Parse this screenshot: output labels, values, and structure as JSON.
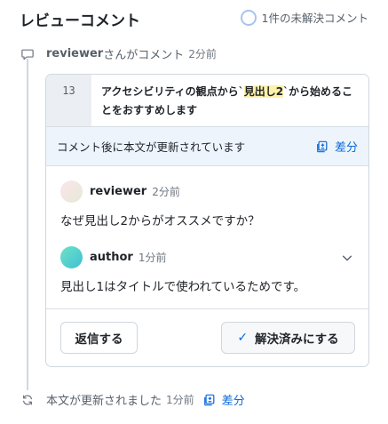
{
  "header": {
    "title": "レビューコメント",
    "unresolved": "1件の未解決コメント"
  },
  "event_comment": {
    "user": "reviewer",
    "action": "さんがコメント",
    "time": "2分前"
  },
  "code": {
    "line_number": "13",
    "text_before": "アクセシビリティの観点から`",
    "highlight": "見出し2",
    "text_after": "`から始めることをおすすめします"
  },
  "notice": {
    "text": "コメント後に本文が更新されています",
    "diff_label": "差分"
  },
  "comments": [
    {
      "user": "reviewer",
      "time": "2分前",
      "body": "なぜ見出し2からがオススメですか？"
    },
    {
      "user": "author",
      "time": "1分前",
      "body": "見出し1はタイトルで使われているためです。"
    }
  ],
  "actions": {
    "reply": "返信する",
    "resolve": "解決済みにする"
  },
  "event_update": {
    "text": "本文が更新されました",
    "time": "1分前",
    "diff_label": "差分"
  },
  "colors": {
    "accent": "#0969da",
    "highlight": "#fff1a8",
    "notice_bg": "#eef4fc"
  }
}
